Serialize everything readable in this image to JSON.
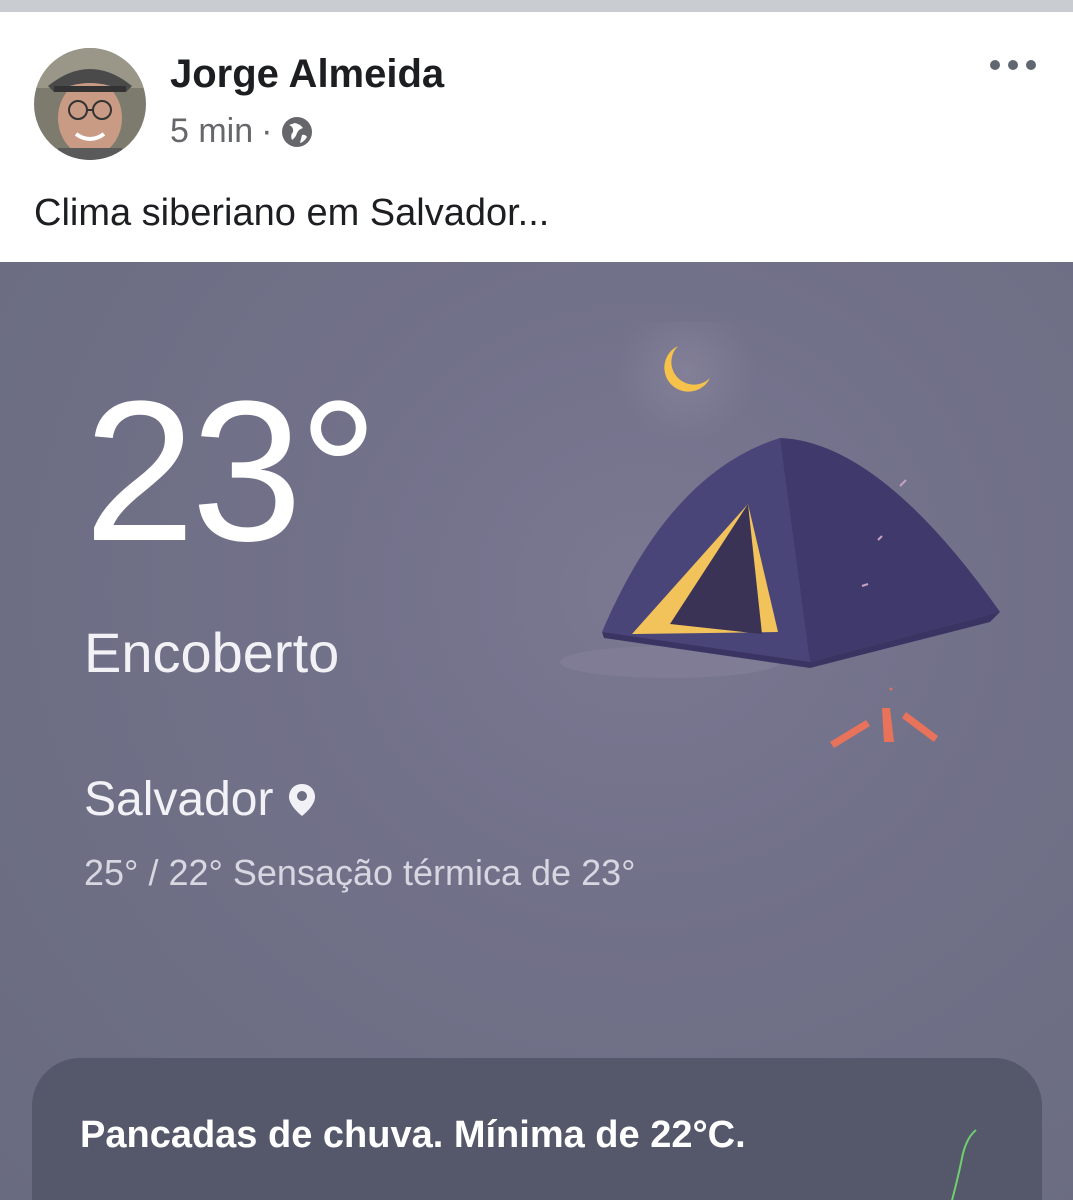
{
  "post": {
    "author": "Jorge Almeida",
    "time": "5 min",
    "separator": "·",
    "text": "Clima siberiano em Salvador...",
    "privacy_icon": "globe-icon",
    "menu_icon": "more-options-icon"
  },
  "weather": {
    "temperature": "23°",
    "condition": "Encoberto",
    "city": "Salvador",
    "range_and_feels_like": "25° / 22° Sensação térmica de 23°",
    "forecast_card": "Pancadas de chuva. Mínima de 22°C.",
    "illustration": "tent-night-icon",
    "location_icon": "location-pin-icon"
  },
  "colors": {
    "background": "#6d6e84",
    "card": "#55576a",
    "tent": "#4a4578",
    "tent_door": "#f2c35a",
    "moon": "#f6c24a",
    "fire": "#e8735a"
  }
}
